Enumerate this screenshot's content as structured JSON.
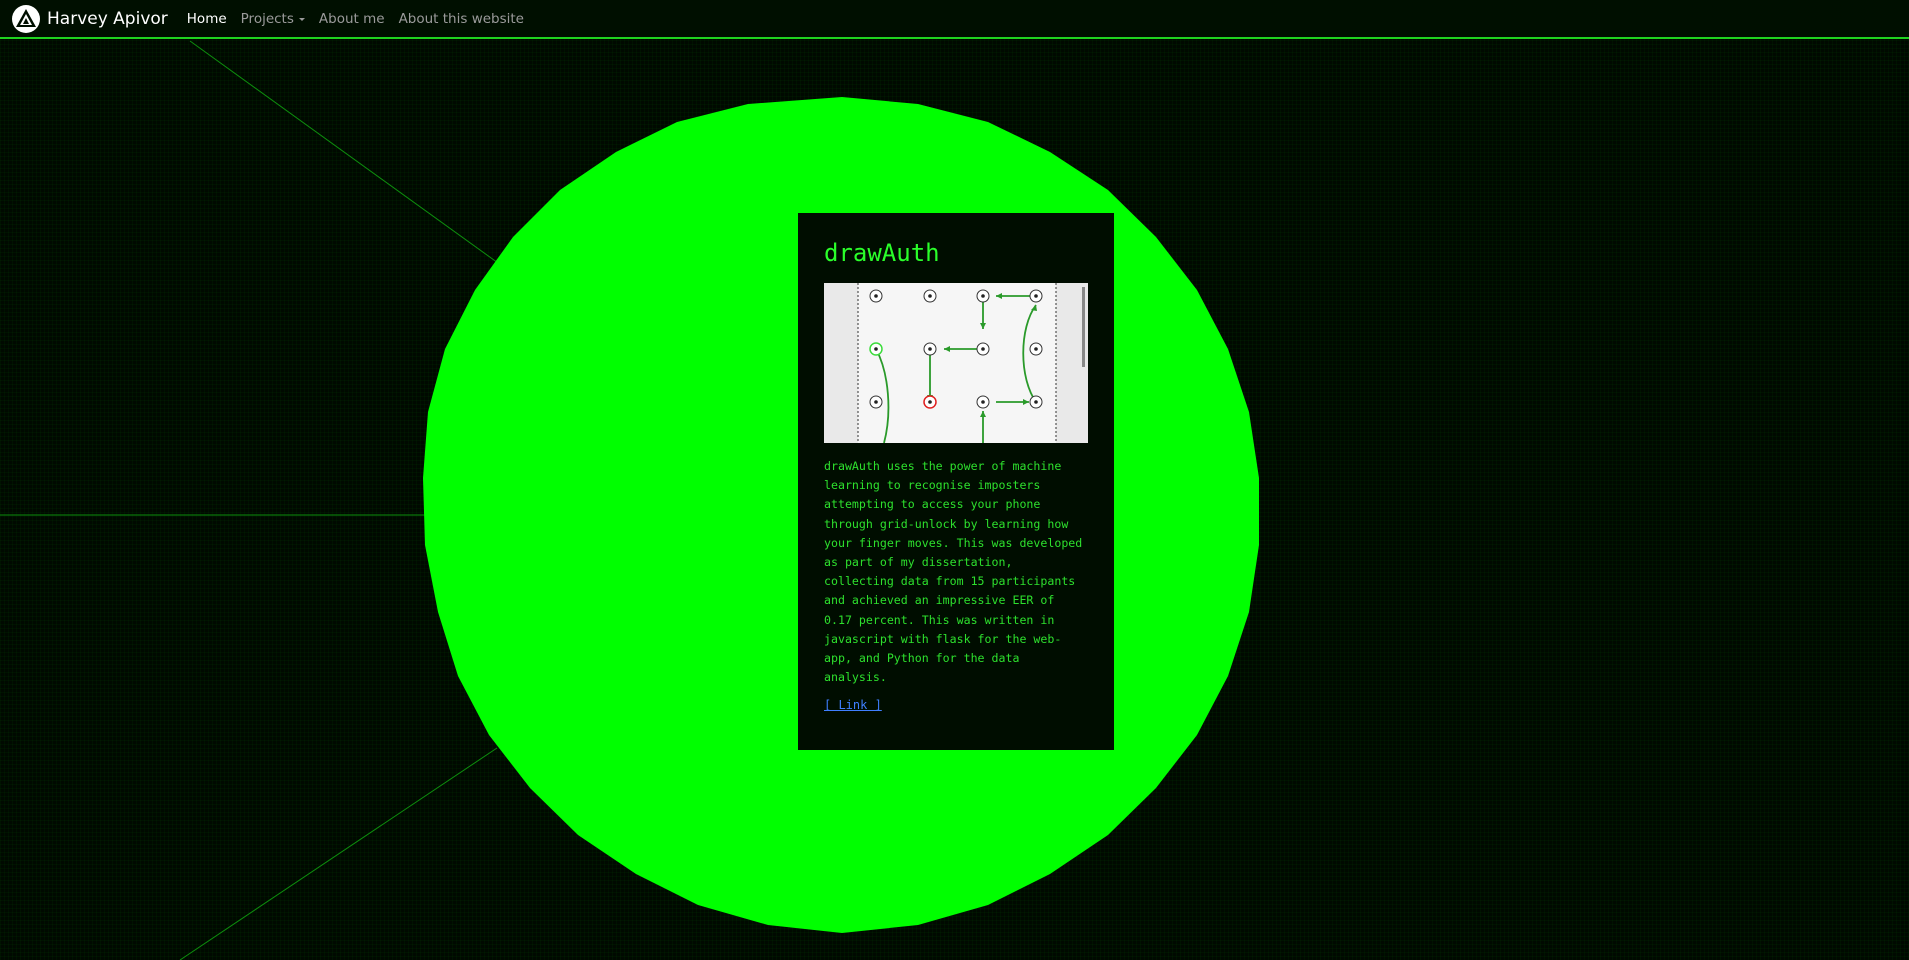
{
  "navbar": {
    "brand": "Harvey Apivor",
    "logo_icon": "triangle-logo-icon",
    "links": [
      {
        "label": "Home",
        "active": true
      },
      {
        "label": "Projects",
        "dropdown": true
      },
      {
        "label": "About me"
      },
      {
        "label": "About this website"
      }
    ]
  },
  "card": {
    "title": "drawAuth",
    "image_icon": "grid-unlock-pattern-image",
    "description": "drawAuth uses the power of machine learning to recognise imposters attempting to access your phone through grid-unlock by learning how your finger moves. This was developed as part of my dissertation, collecting data from 15 participants and achieved an impressive EER of 0.17 percent. This was written in javascript with flask for the web-app, and Python for the data analysis.",
    "link_label": "[ Link ]"
  },
  "colors": {
    "accent": "#00ff00",
    "background": "#000900",
    "card_bg": "#000d00",
    "link": "#3f7fff"
  }
}
